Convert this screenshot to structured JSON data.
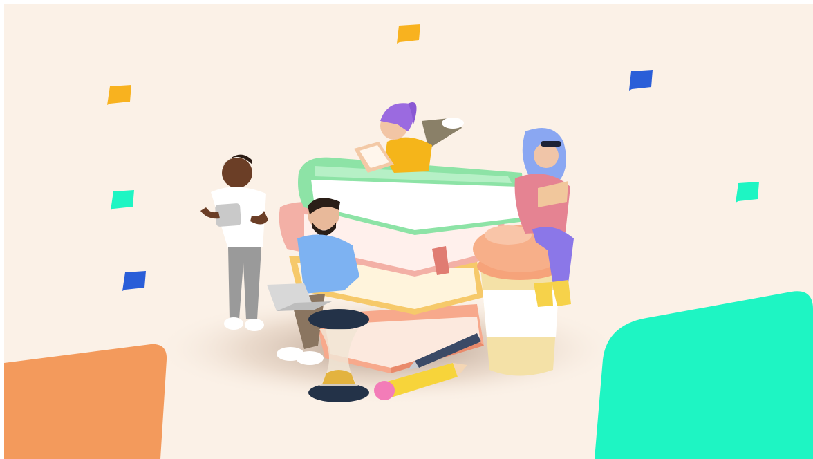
{
  "scene": {
    "background_color": "#FBF1E7",
    "accent_colors": {
      "orange": "#F39A5C",
      "green": "#1EF5C3",
      "blue": "#2A5ED8",
      "amber": "#F8B21F",
      "mint_book": "#8DE3A6",
      "pink_book": "#F3B0A6",
      "yellow_book": "#F6C96A",
      "peach_book": "#F7A98C"
    },
    "icons": [
      "chat-bubble-amber-icon",
      "chat-bubble-blue-icon",
      "chat-bubble-green-icon"
    ]
  }
}
